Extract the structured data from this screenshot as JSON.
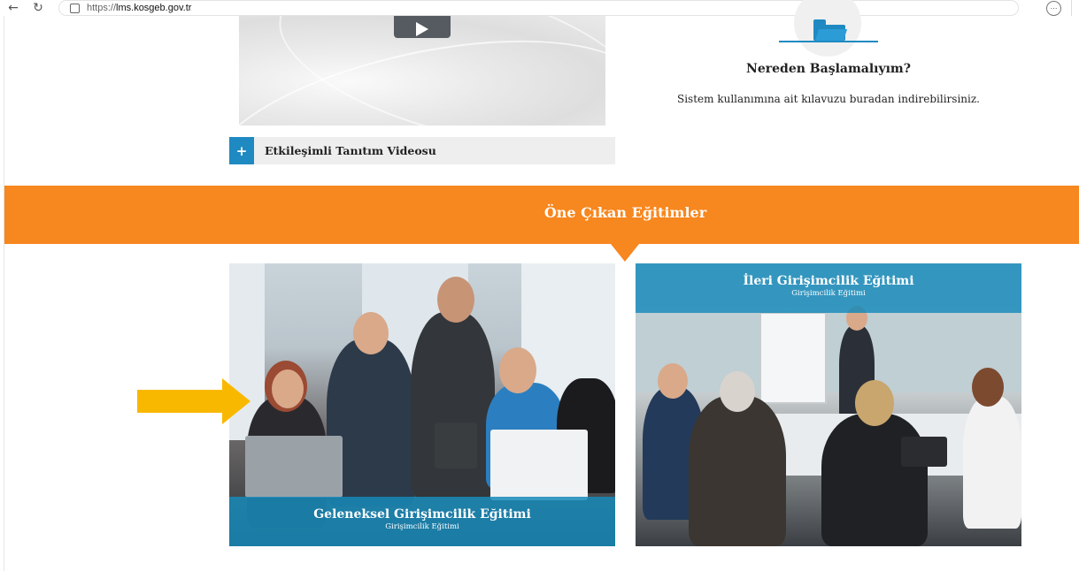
{
  "browser": {
    "url_scheme": "https://",
    "url_host": "lms.kosgeb.gov.tr",
    "back_icon": "back-arrow-icon",
    "reload_icon": "reload-icon",
    "more_icon": "more-options-icon"
  },
  "intro": {
    "video_toggle_label": "Etkileşimli Tanıtım Videosu",
    "video_toggle_symbol": "+"
  },
  "start": {
    "title": "Nereden Başlamalıyım?",
    "description": "Sistem kullanımına ait kılavuzu buradan indirebilirsiniz.",
    "icon": "folder-icon"
  },
  "featured": {
    "title": "Öne Çıkan Eğitimler",
    "courses": [
      {
        "title": "Geleneksel Girişimcilik Eğitimi",
        "subtitle": "Girişimcilik Eğitimi"
      },
      {
        "title": "İleri Girişimcilik Eğitimi",
        "subtitle": "Girişimcilik Eğitimi"
      }
    ]
  },
  "colors": {
    "accent_orange": "#f7871f",
    "accent_blue": "#1f8ac2",
    "annotation_arrow": "#f9b800"
  }
}
